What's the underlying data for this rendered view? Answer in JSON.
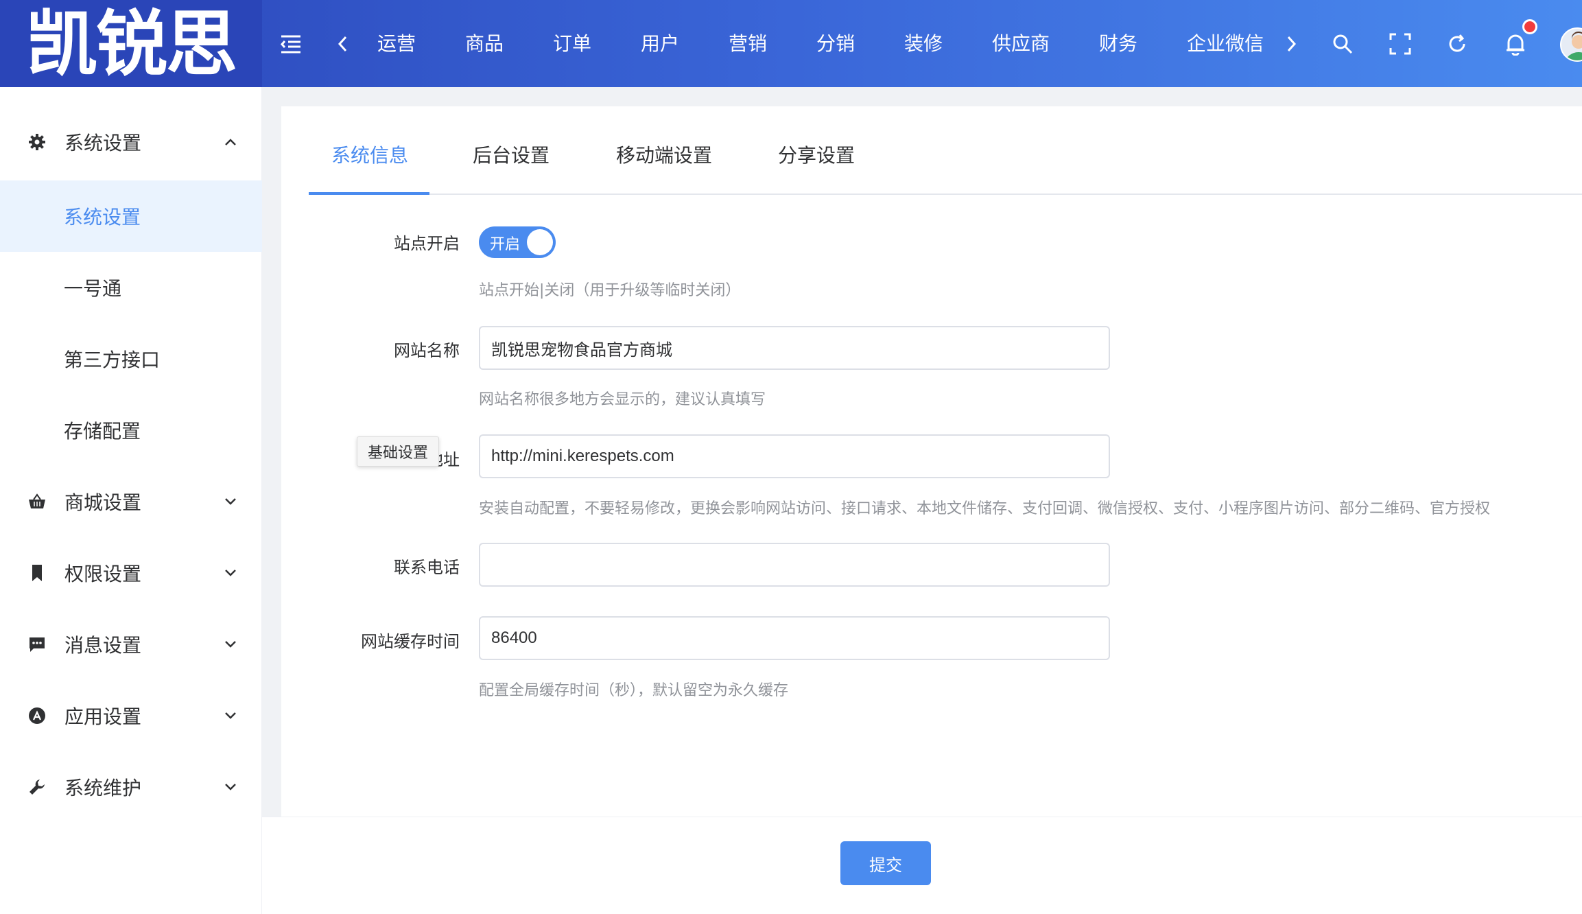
{
  "brand": {
    "logo_text": "凯锐思"
  },
  "topnav": {
    "items": [
      "运营",
      "商品",
      "订单",
      "用户",
      "营销",
      "分销",
      "装修",
      "供应商",
      "财务",
      "企业微信"
    ]
  },
  "sidebar": {
    "groups": [
      {
        "label": "系统设置",
        "icon": "gear-icon",
        "expanded": true,
        "children": [
          "系统设置",
          "一号通",
          "第三方接口",
          "存储配置"
        ],
        "active_child": "系统设置"
      },
      {
        "label": "商城设置",
        "icon": "basket-icon",
        "expanded": false
      },
      {
        "label": "权限设置",
        "icon": "bookmark-icon",
        "expanded": false
      },
      {
        "label": "消息设置",
        "icon": "message-icon",
        "expanded": false
      },
      {
        "label": "应用设置",
        "icon": "appstore-icon",
        "expanded": false
      },
      {
        "label": "系统维护",
        "icon": "wrench-icon",
        "expanded": false
      }
    ]
  },
  "tabs": [
    "系统信息",
    "后台设置",
    "移动端设置",
    "分享设置"
  ],
  "active_tab": "系统信息",
  "form": {
    "site_open": {
      "label": "站点开启",
      "switch_text": "开启",
      "on": true,
      "hint": "站点开始|关闭（用于升级等临时关闭）"
    },
    "site_name": {
      "label": "网站名称",
      "value": "凯锐思宠物食品官方商城",
      "hint": "网站名称很多地方会显示的，建议认真填写"
    },
    "site_url": {
      "label_visible": "地址",
      "value": "http://mini.kerespets.com",
      "hint": "安装自动配置，不要轻易修改，更换会影响网站访问、接口请求、本地文件储存、支付回调、微信授权、支付、小程序图片访问、部分二维码、官方授权"
    },
    "phone": {
      "label": "联系电话",
      "value": ""
    },
    "cache_time": {
      "label": "网站缓存时间",
      "value": "86400",
      "hint": "配置全局缓存时间（秒），默认留空为永久缓存"
    }
  },
  "tooltip": "基础设置",
  "submit_label": "提交",
  "colors": {
    "accent": "#4a8bef",
    "header_dark": "#2a45b8",
    "notification_dot": "#f23c3c"
  }
}
